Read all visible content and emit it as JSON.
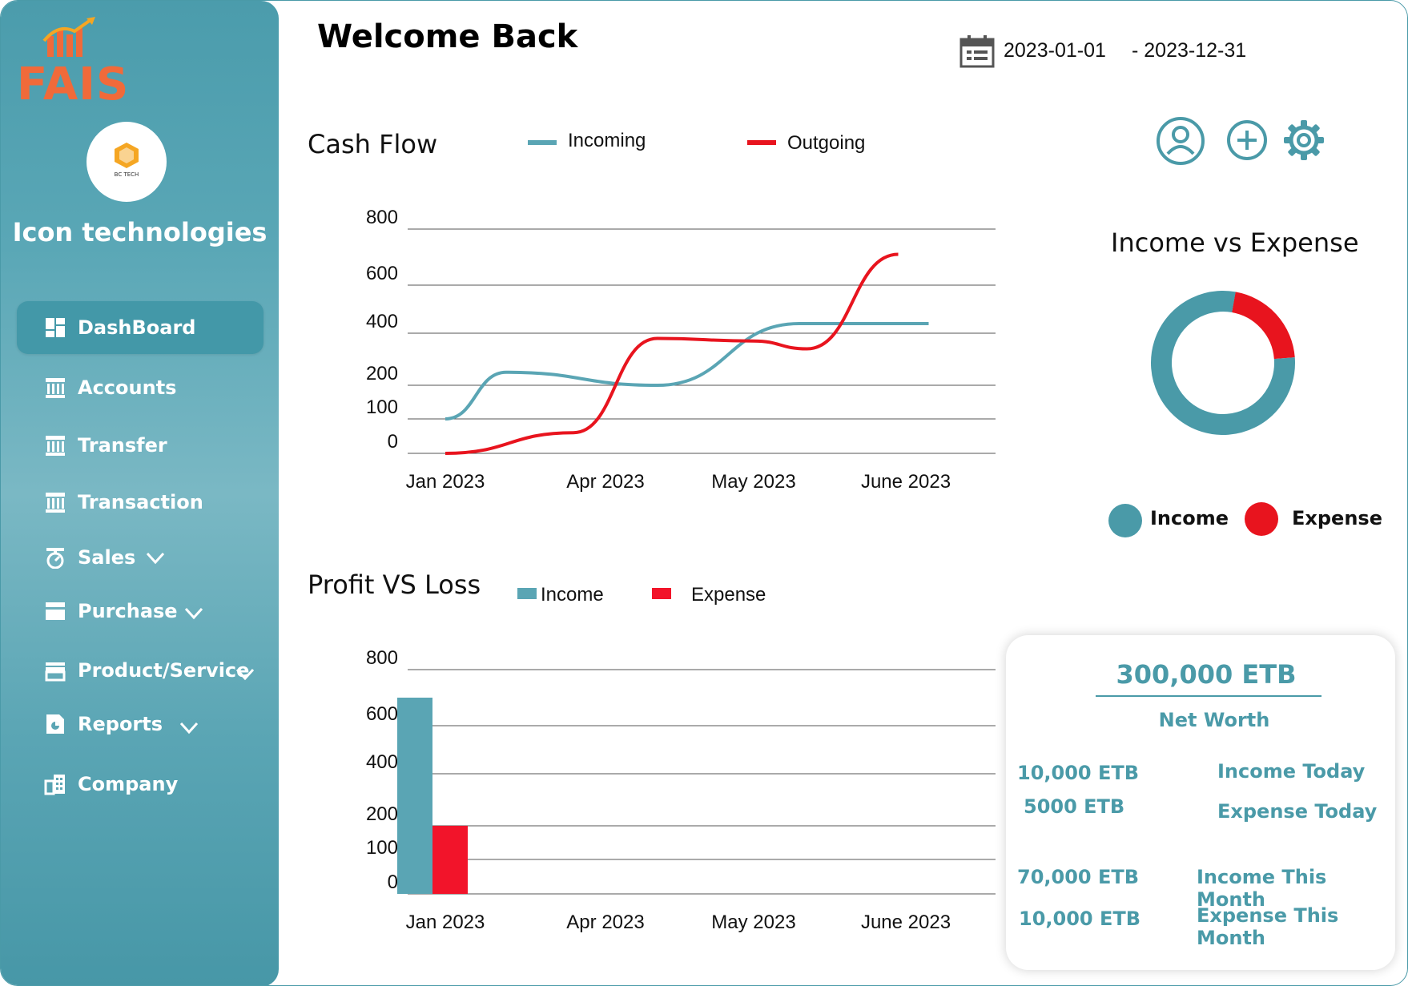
{
  "brand": {
    "logo_text": "FAIS",
    "avatar_text": "BC TECH",
    "company_name": "Icon  technologies"
  },
  "sidebar": {
    "items": [
      {
        "label": "DashBoard",
        "icon": "dashboard-icon",
        "active": true,
        "expandable": false
      },
      {
        "label": "Accounts",
        "icon": "bank-icon",
        "active": false,
        "expandable": false
      },
      {
        "label": "Transfer",
        "icon": "bank-icon",
        "active": false,
        "expandable": false
      },
      {
        "label": "Transaction",
        "icon": "bank-icon",
        "active": false,
        "expandable": false
      },
      {
        "label": "Sales",
        "icon": "scale-icon",
        "active": false,
        "expandable": true
      },
      {
        "label": "Purchase",
        "icon": "card-icon",
        "active": false,
        "expandable": true
      },
      {
        "label": "Product/Service",
        "icon": "store-icon",
        "active": false,
        "expandable": true
      },
      {
        "label": "Reports",
        "icon": "report-icon",
        "active": false,
        "expandable": true
      },
      {
        "label": "Company",
        "icon": "building-icon",
        "active": false,
        "expandable": false
      }
    ]
  },
  "header": {
    "title": "Welcome Back",
    "date_from": "2023-01-01",
    "date_to": "- 2023-12-31"
  },
  "top_icons": [
    "user-icon",
    "add-icon",
    "gear-icon"
  ],
  "colors": {
    "teal": "#4a9aa8",
    "red": "#e8141e",
    "orange": "#f06a3a"
  },
  "cashflow": {
    "title": "Cash Flow",
    "legend": [
      "Incoming",
      "Outgoing"
    ]
  },
  "profitloss": {
    "title": "Profit VS Loss",
    "legend": [
      "Income",
      "Expense"
    ]
  },
  "donut": {
    "title": "Income vs Expense",
    "legend": [
      "Income",
      "Expense"
    ]
  },
  "stats": {
    "net_worth_value": "300,000 ETB",
    "net_worth_label": "Net Worth",
    "rows": [
      {
        "value": "10,000 ETB",
        "label": "Income Today"
      },
      {
        "value": "5000 ETB",
        "label": "Expense Today"
      },
      {
        "value": "70,000 ETB",
        "label": "Income This Month"
      },
      {
        "value": "10,000 ETB",
        "label": "Expense This Month"
      }
    ]
  },
  "chart_data": [
    {
      "type": "line",
      "title": "Cash Flow",
      "categories": [
        "Jan 2023",
        "Apr 2023",
        "May 2023",
        "June 2023"
      ],
      "y_ticks": [
        "800",
        "600",
        "400",
        "200",
        "100",
        "0"
      ],
      "series": [
        {
          "name": "Incoming",
          "color": "#5aa5b4",
          "values": [
            {
              "x": 0,
              "y": 100
            },
            {
              "x": 0.38,
              "y": 250
            },
            {
              "x": 1.35,
              "y": 200
            },
            {
              "x": 2.3,
              "y": 440
            },
            {
              "x": 3.15,
              "y": 440
            }
          ]
        },
        {
          "name": "Outgoing",
          "color": "#e8141e",
          "values": [
            {
              "x": 0,
              "y": 0
            },
            {
              "x": 0.8,
              "y": 60
            },
            {
              "x": 1.35,
              "y": 380
            },
            {
              "x": 2.0,
              "y": 370
            },
            {
              "x": 2.35,
              "y": 340
            },
            {
              "x": 2.95,
              "y": 710
            }
          ]
        }
      ]
    },
    {
      "type": "bar",
      "title": "Profit VS Loss",
      "categories": [
        "Jan 2023",
        "Apr 2023",
        "May 2023",
        "June 2023"
      ],
      "y_ticks": [
        "800",
        "600",
        "400",
        "200",
        "100",
        "0"
      ],
      "series": [
        {
          "name": "Income",
          "color": "#5aa5b4",
          "values": [
            700,
            null,
            null,
            null
          ]
        },
        {
          "name": "Expense",
          "color": "#f2142a",
          "values": [
            200,
            null,
            null,
            null
          ]
        }
      ]
    },
    {
      "type": "pie",
      "title": "Income vs Expense",
      "series": [
        {
          "name": "Income",
          "color": "#4a9aa8",
          "value": 79
        },
        {
          "name": "Expense",
          "color": "#e8141e",
          "value": 21
        }
      ]
    }
  ]
}
